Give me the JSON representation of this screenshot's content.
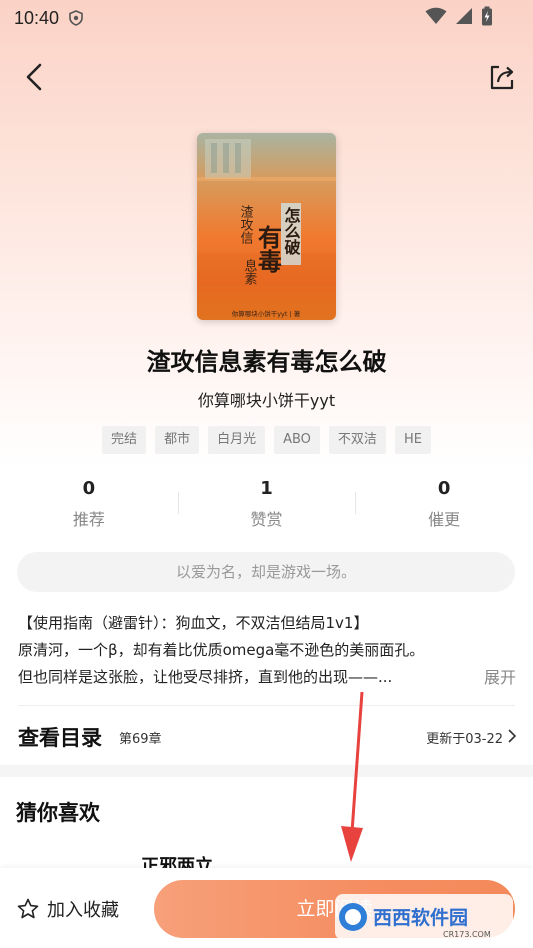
{
  "status_bar": {
    "time": "10:40"
  },
  "book": {
    "title": "渣攻信息素有毒怎么破",
    "author": "你算哪块小饼干yyt",
    "cover": {
      "title_chars_1": "渣攻信",
      "title_chars_2": "息素",
      "big_chars": "有毒",
      "side_chars": "怎么破",
      "small_text": "你算哪块小饼干yyt | 著"
    },
    "tags": [
      "完结",
      "都市",
      "白月光",
      "ABO",
      "不双洁",
      "HE"
    ],
    "stats": [
      {
        "value": "0",
        "label": "推荐"
      },
      {
        "value": "1",
        "label": "赞赏"
      },
      {
        "value": "0",
        "label": "催更"
      }
    ],
    "slogan": "以爱为名，却是游戏一场。",
    "intro": [
      "【使用指南（避雷针）：狗血文，不双洁但结局1v1】",
      "原清河，一个β，却有着比优质omega毫不逊色的美丽面孔。",
      "但也同样是这张脸，让他受尽排挤，直到他的出现——..."
    ],
    "expand_label": "展开"
  },
  "toc": {
    "title": "查看目录",
    "chapter": "第69章",
    "update": "更新于03-22"
  },
  "recommend": {
    "title": "猜你喜欢",
    "first_item": "正邪两立"
  },
  "bottom": {
    "favorite_label": "加入收藏",
    "read_label": "立即阅读"
  },
  "watermark": {
    "text": "西西软件园",
    "url": "CR173.COM"
  },
  "colors": {
    "accent": "#f58d61",
    "annotation_arrow": "#e8423f"
  }
}
